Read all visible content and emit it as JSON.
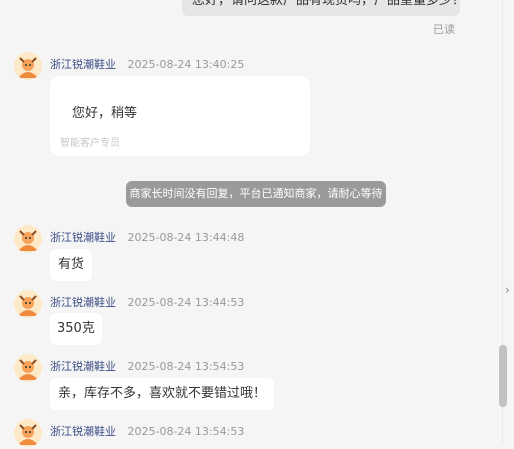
{
  "chat": {
    "outgoing_partial": "您好，请问这款广品有现货吗，广品重量多少？",
    "read_status": "已读",
    "side_chevron_glyph": "›",
    "messages": [
      {
        "shop": "浙江锐潮鞋业",
        "time": "2025-08-24 13:40:25",
        "card_text": "您好，稍等",
        "card_sub": "智能客户专员"
      },
      {
        "notice": "商家长时间没有回复，平台已通知商家，请耐心等待"
      },
      {
        "shop": "浙江锐潮鞋业",
        "time": "2025-08-24 13:44:48",
        "text": "有货"
      },
      {
        "shop": "浙江锐潮鞋业",
        "time": "2025-08-24 13:44:53",
        "text": "350克"
      },
      {
        "shop": "浙江锐潮鞋业",
        "time": "2025-08-24 13:54:53",
        "text": "亲，库存不多，喜欢就不要错过哦！"
      },
      {
        "shop": "浙江锐潮鞋业",
        "time": "2025-08-24 13:54:53"
      }
    ]
  },
  "colors": {
    "bg": "#f5f5f5",
    "bubble": "#ffffff",
    "shop_name": "#3b4c86",
    "notice_bg": "#9a9a9a",
    "avatar_bg": "#fde9c8",
    "avatar_orange": "#f08a3c"
  }
}
